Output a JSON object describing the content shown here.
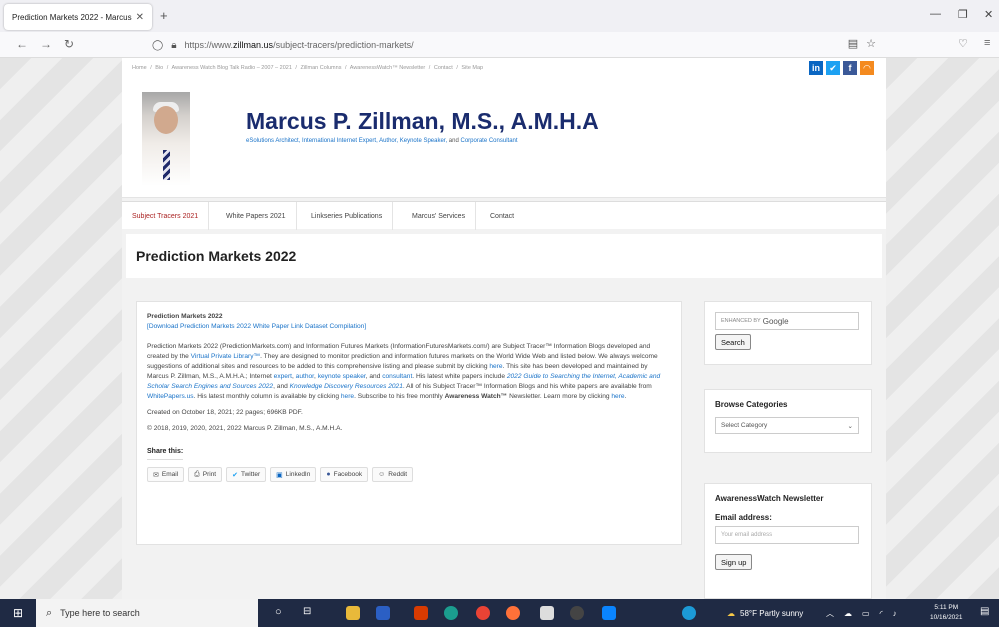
{
  "browser": {
    "tab_title": "Prediction Markets 2022 - Marcus P",
    "url_prefix": "https://www.",
    "url_domain": "zillman.us",
    "url_path": "/subject-tracers/prediction-markets/"
  },
  "site": {
    "top_links": [
      "Home",
      "/",
      "Bio",
      "/",
      "Awareness Watch Blog Talk Radio – 2007 – 2021",
      "/",
      "Zillman Columns",
      "/",
      "AwarenessWatch™ Newsletter",
      "/",
      "Contact",
      "/",
      "Site Map"
    ],
    "title": "Marcus P. Zillman, M.S., A.M.H.A",
    "tagline": {
      "p1": "eSolutions Architect, International Internet Expert, Author, Keynote Speaker,",
      "p2": " and ",
      "p3": "Corporate Consultant"
    },
    "nav": [
      "Subject Tracers 2021",
      "White Papers 2021",
      "Linkseries Publications",
      "Marcus' Services",
      "Contact"
    ]
  },
  "page_title": "Prediction Markets 2022",
  "content": {
    "title": "Prediction Markets 2022",
    "download_link": "[Download Prediction Markets 2022 White Paper Link Dataset Compilation]",
    "p1_a": "Prediction Markets 2022 (PredictionMarkets.com) and Information Futures Markets (InformationFuturesMarkets.com/) are  Subject Tracer™ Information Blogs developed and created by the ",
    "p1_link_vpl": "Virtual Private Library™",
    "p1_b": ". They are designed to monitor prediction and information futures markets on the World Wide Web and listed below. We always welcome suggestions of additional sites and resources to be added to this comprehensive listing and please submit by clicking ",
    "p1_here1": "here",
    "p1_c": ". This site has been developed and maintained by Marcus P. Zillman, M.S., A.M.H.A.; Internet ",
    "p1_expert": "expert",
    "p1_comma1": ", ",
    "p1_author": "author",
    "p1_comma2": ", ",
    "p1_keynote": "keynote speaker",
    "p1_comma3": ", and ",
    "p1_consultant": "consultant",
    "p1_d": ". His latest white papers include ",
    "p1_guide": "2022 Guide to Searching the Internet, Academic and Scholar Search Engines and Sources 2022",
    "p1_and": ", and ",
    "p1_kdr": "Knowledge Discovery Resources 2021",
    "p1_e": ". All of his Subject Tracer™ Information Blogs and his white papers are available from ",
    "p1_wp": "WhitePapers.us",
    "p1_f": ". His latest monthly column is available by clicking ",
    "p1_here2": "here",
    "p1_g": ". Subscribe to his free monthly ",
    "p1_aw": "Awareness Watch™",
    "p1_h": " Newsletter. Learn more by clicking ",
    "p1_here3": "here",
    "p1_i": ".",
    "created": "Created on October 18, 2021; 22 pages; 696KB PDF.",
    "copyright": "© 2018, 2019, 2020, 2021, 2022 Marcus P. Zillman, M.S., A.M.H.A.",
    "share_title": "Share this:",
    "share_buttons": [
      "Email",
      "Print",
      "Twitter",
      "LinkedIn",
      "Facebook",
      "Reddit"
    ]
  },
  "sidebar": {
    "search_brand": "ENHANCED BY",
    "search_google": "Google",
    "search_button": "Search",
    "categories_title": "Browse Categories",
    "categories_select": "Select Category",
    "newsletter_title": "AwarenessWatch Newsletter",
    "email_label": "Email address:",
    "email_placeholder": "Your email address",
    "signup_button": "Sign up"
  },
  "taskbar": {
    "search_placeholder": "Type here to search",
    "weather": "58°F  Partly sunny",
    "time": "5:11 PM",
    "date": "10/16/2021"
  },
  "colors": {
    "accent": "#1a73c8",
    "title": "#1a2c6e",
    "linkedin": "#0a66c2",
    "twitter": "#1da1f2",
    "facebook": "#3b5998",
    "rss": "#f48a1f"
  }
}
